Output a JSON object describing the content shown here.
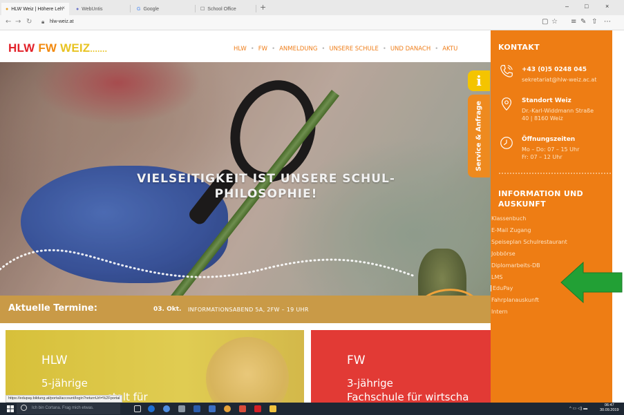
{
  "browser": {
    "tabs": [
      {
        "label": "HLW Weiz | Höhere Leh",
        "active": true
      },
      {
        "label": "WebUntis",
        "active": false
      },
      {
        "label": "Google",
        "active": false
      },
      {
        "label": "School Office",
        "active": false
      }
    ],
    "close_glyph": "×",
    "new_tab_glyph": "+",
    "url": "hlw-weiz.at",
    "window_controls": [
      "–",
      "□",
      "×"
    ],
    "nav_icons": [
      "back-icon",
      "forward-icon",
      "refresh-icon"
    ],
    "toolbar_icons": [
      "reading-view-icon",
      "favorites-star-icon",
      "hub-icon",
      "web-note-icon",
      "share-icon",
      "more-icon"
    ]
  },
  "site": {
    "logo": {
      "part1": "HLW",
      "part2": "FW",
      "part3": "WEIZ",
      "dots": "......."
    },
    "nav": [
      "HLW",
      "FW",
      "ANMELDUNG",
      "UNSERE SCHULE",
      "UND DANACH",
      "AKTU"
    ],
    "nav_separator": "•",
    "hero_title": "VIELSEITIGKEIT IST UNSERE SCHUL-PHILOSOPHIE!",
    "termine": {
      "label": "Aktuelle Termine:",
      "date": "03. Okt.",
      "text": "INFORMATIONSABEND 5A, 2FW – 19 UHR"
    },
    "cards": {
      "hlw": {
        "title": "HLW",
        "sub": "5-jährige",
        "sub2": "stalt für"
      },
      "fw": {
        "title": "FW",
        "sub": "3-jährige",
        "sub2": "Fachschule für wirtscha"
      }
    },
    "status_url": "https://edupay.bildung.at/portal/account/login?returnUrl=%2Fportal"
  },
  "service": {
    "info_glyph": "i",
    "tab_label": "Service & Anfrage"
  },
  "panel": {
    "heading": "KONTAKT",
    "phone": "+43 (0)5 0248 045",
    "email": "sekretariat@hlw-weiz.ac.at",
    "location_title": "Standort Weiz",
    "address_line1": "Dr.-Karl-Widdmann Straße",
    "address_line2": "40 | 8160 Weiz",
    "hours_title": "Öffnungszeiten",
    "hours_line1": "Mo – Do: 07 – 15 Uhr",
    "hours_line2": "Fr: 07 – 12 Uhr",
    "info_heading_line1": "INFORMATION UND",
    "info_heading_line2": "AUSKUNFT",
    "links": [
      "Klassenbuch",
      "E-Mail Zugang",
      "Speiseplan Schulrestaurant",
      "Jobbörse",
      "Diplomarbeits-DB",
      "LMS",
      "EduPay",
      "Fahrplanauskunft",
      "Intern"
    ],
    "highlighted_link": "EduPay"
  },
  "annotation": {
    "arrow_color": "#22a035"
  },
  "taskbar": {
    "search_placeholder": "Ich bin Cortana. Frag mich etwas.",
    "clock_time": "06:47",
    "clock_date": "30.09.2019",
    "apps": [
      "task-view-icon",
      "edge-icon",
      "chrome-icon",
      "calculator-icon",
      "word-icon",
      "onenote-icon",
      "chrome-user-icon",
      "paint-icon",
      "acrobat-icon",
      "file-explorer-icon"
    ]
  },
  "colors": {
    "panel_orange": "#ee7d14",
    "hlw_red": "#e2222a",
    "fw_orange": "#f28a10",
    "weiz_yellow": "#e8c322",
    "termine_bar": "#c99a47",
    "hlw_card": "#d7c03a",
    "fw_card": "#e23a35"
  }
}
